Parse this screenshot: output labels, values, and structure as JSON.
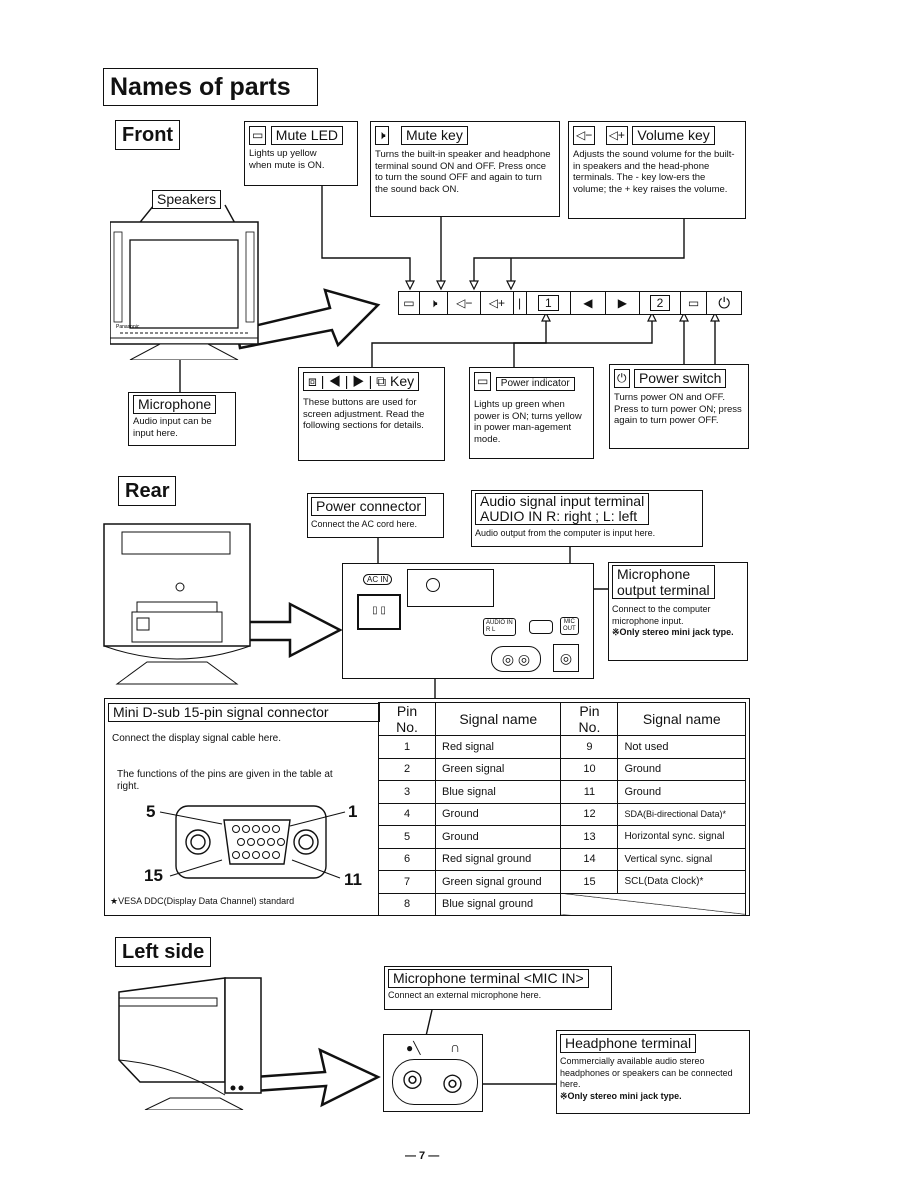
{
  "page": {
    "title": "Names of parts",
    "page_number": "— 7 —"
  },
  "front": {
    "section_title": "Front",
    "speakers_label": "Speakers",
    "mute_led": {
      "title": "Mute LED",
      "description": "Lights up yellow when mute is ON."
    },
    "mute_key": {
      "title": "Mute key",
      "description": "Turns the built-in speaker and headphone terminal sound ON and OFF. Press once to turn the sound OFF and again to turn the sound back ON."
    },
    "volume_key": {
      "title": "Volume key",
      "minus_icon": "speaker-minus",
      "plus_icon": "speaker-plus",
      "description": "Adjusts the sound volume for the built-in speakers and the head-phone terminals. The - key low-ers the volume; the + key raises the volume."
    },
    "adjust_keys": {
      "title": "Key",
      "icons": [
        "1",
        "◀",
        "▶",
        "2"
      ],
      "description": "These buttons are used for screen adjustment. Read the following sections for details."
    },
    "power_indicator": {
      "title": "Power indicator",
      "description": "Lights up green when power is ON; turns yellow in power man-agement mode."
    },
    "power_switch": {
      "title": "Power switch",
      "description": "Turns power ON and OFF. Press to turn power ON; press again to turn power OFF."
    },
    "microphone": {
      "title": "Microphone",
      "description": "Audio input can be input here."
    },
    "control_panel": [
      "▭",
      "🕨×",
      "◁−",
      "◁+",
      "|",
      "1",
      "◀",
      "▶",
      "2",
      "▭",
      "⏻"
    ],
    "monitor_brand": "Panasonic"
  },
  "rear": {
    "section_title": "Rear",
    "power_connector": {
      "title": "Power connector",
      "description": "Connect the AC cord here.",
      "port_label": "AC IN"
    },
    "audio_in": {
      "title_line1": "Audio signal input terminal",
      "title_line2": "AUDIO IN R: right ; L: left",
      "description": "Audio output from the computer is input here.",
      "port_label_1": "AUDIO IN",
      "port_label_2": "R     L"
    },
    "mic_out": {
      "title_line1": "Microphone",
      "title_line2": "output terminal",
      "description": "Connect to the computer microphone input.",
      "note": "※Only stereo mini jack type.",
      "port_label_1": "MIC",
      "port_label_2": "OUT"
    },
    "dsub": {
      "title": "Mini D-sub 15-pin signal connector",
      "description": "Connect the display signal cable here.",
      "pins_note": "The functions of the pins are given in the table at right.",
      "pin_labels": [
        "5",
        "1",
        "15",
        "11"
      ],
      "footnote": "★VESA DDC(Display Data Channel) standard"
    },
    "pin_table": {
      "headers": [
        "Pin No.",
        "Signal name",
        "Pin No.",
        "Signal name"
      ],
      "rows": [
        [
          "1",
          "Red signal",
          "9",
          "Not used"
        ],
        [
          "2",
          "Green signal",
          "10",
          "Ground"
        ],
        [
          "3",
          "Blue signal",
          "11",
          "Ground"
        ],
        [
          "4",
          "Ground",
          "12",
          "SDA(Bi-directional Data)*"
        ],
        [
          "5",
          "Ground",
          "13",
          "Horizontal sync. signal"
        ],
        [
          "6",
          "Red signal ground",
          "14",
          "Vertical sync. signal"
        ],
        [
          "7",
          "Green signal ground",
          "15",
          "SCL(Data Clock)*"
        ],
        [
          "8",
          "Blue signal ground",
          "",
          ""
        ]
      ]
    }
  },
  "left_side": {
    "section_title": "Left side",
    "mic_in": {
      "title": "Microphone terminal <MIC IN>",
      "description": "Connect an external microphone here."
    },
    "headphone": {
      "title": "Headphone terminal",
      "description": "Commercially available audio stereo headphones or speakers can be connected here.",
      "note": "※Only stereo mini  jack type."
    }
  }
}
